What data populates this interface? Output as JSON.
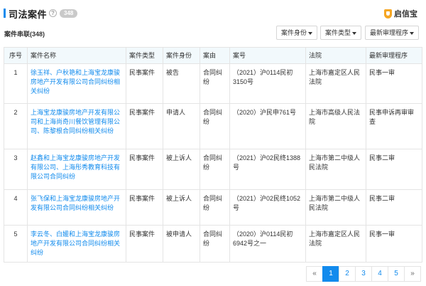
{
  "header": {
    "title": "司法案件",
    "help_glyph": "?",
    "count_badge": "348",
    "brand": "启信宝"
  },
  "subheader": {
    "label": "案件串联(348)",
    "filters": [
      "案件身份",
      "案件类型",
      "最新审理程序"
    ]
  },
  "table": {
    "columns": [
      "序号",
      "案件名称",
      "案件类型",
      "案件身份",
      "案由",
      "案号",
      "法院",
      "最新审理程序"
    ],
    "rows": [
      {
        "no": "1",
        "name": "徐玉祥、户秋艳和上海宝龙康骏房地产开发有限公司合同纠纷相关纠纷",
        "type": "民事案件",
        "role": "被告",
        "cause": "合同纠纷",
        "case_no": "（2021）沪0114民初3150号",
        "court": "上海市嘉定区人民法院",
        "procedure": "民事一审"
      },
      {
        "no": "2",
        "name": "上海宝龙康骏房地产开发有限公司和上海尚奇川餐饮管理有限公司、陈黎根合同纠纷相关纠纷",
        "type": "民事案件",
        "role": "申请人",
        "cause": "合同纠纷",
        "case_no": "（2020）沪民申761号",
        "court": "上海市高级人民法院",
        "procedure": "民事申诉再审审查"
      },
      {
        "no": "3",
        "name": "赵鑫和上海宝龙康骏房地产开发有限公司、上海彤秀教育科技有限公司合同纠纷",
        "type": "民事案件",
        "role": "被上诉人",
        "cause": "合同纠纷",
        "case_no": "（2021）沪02民终1388号",
        "court": "上海市第二中级人民法院",
        "procedure": "民事二审"
      },
      {
        "no": "4",
        "name": "张飞保和上海宝龙康骏房地产开发有限公司合同纠纷相关纠纷",
        "type": "民事案件",
        "role": "被上诉人",
        "cause": "合同纠纷",
        "case_no": "（2021）沪02民终1052号",
        "court": "上海市第二中级人民法院",
        "procedure": "民事二审"
      },
      {
        "no": "5",
        "name": "李云冬、白媛和上海宝龙康骏房地产开发有限公司合同纠纷相关纠纷",
        "type": "民事案件",
        "role": "被申请人",
        "cause": "合同纠纷",
        "case_no": "（2020）沪0114民初6942号之一",
        "court": "上海市嘉定区人民法院",
        "procedure": "民事一审"
      }
    ]
  },
  "pagination": {
    "prev": "«",
    "pages": [
      "1",
      "2",
      "3",
      "4",
      "5"
    ],
    "active": "1",
    "next": "»"
  },
  "colors": {
    "accent": "#128bed",
    "header_bg": "#f2f9fc",
    "border": "#e4e4e4",
    "badge": "#c9c9c9",
    "brand_icon": "#f5a623"
  }
}
